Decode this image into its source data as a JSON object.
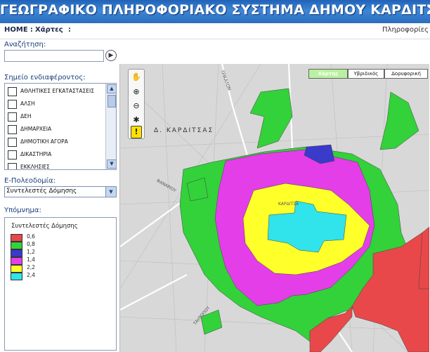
{
  "header": {
    "title": "ΓΕΩΓΡΑΦΙΚΟ ΠΛΗΡΟΦΟΡΙΑΚΟ ΣΥΣΤΗΜΑ ΔΗΜΟΥ ΚΑΡΔΙΤΣΑΣ"
  },
  "nav": {
    "home": "HOME",
    "separator": ":",
    "current": "Χάρτες",
    "trailing": ":",
    "info": "Πληροφορίες"
  },
  "sidebar": {
    "search_label": "Αναζήτηση:",
    "search_value": "",
    "go_icon": "arrow-right-icon",
    "poi_label": "Σημείο ενδιαφέροντος:",
    "poi_items": [
      {
        "label": "ΑΘΛΗΤΙΚΕΣ ΕΓΚΑΤΑΣΤΑΣΕΙΣ",
        "checked": false
      },
      {
        "label": "ΑΛΣΗ",
        "checked": false
      },
      {
        "label": "ΔΕΗ",
        "checked": false
      },
      {
        "label": "ΔΗΜΑΡΧΕΙΑ",
        "checked": false
      },
      {
        "label": "ΔΗΜΟΤΙΚΗ ΑΓΟΡΑ",
        "checked": false
      },
      {
        "label": "ΔΙΚΑΣΤΗΡΙΑ",
        "checked": false
      },
      {
        "label": "ΕΚΚΛΗΣΙΕΣ",
        "checked": false
      }
    ],
    "epoleodomia_label": "Ε-Πολεοδομία:",
    "epoleodomia_selected": "Συντελεστές Δόμησης",
    "legend_label": "Υπόμνημα:",
    "legend": {
      "title": "Συντελεστές Δόμησης",
      "items": [
        {
          "value": "0,6",
          "color": "#e8484a"
        },
        {
          "value": "0,8",
          "color": "#33d13a"
        },
        {
          "value": "1,2",
          "color": "#3a3acb"
        },
        {
          "value": "1,4",
          "color": "#e33ee8"
        },
        {
          "value": "2,2",
          "color": "#ffff2a"
        },
        {
          "value": "2,4",
          "color": "#31e3ea"
        }
      ]
    }
  },
  "map": {
    "type_buttons": [
      {
        "label": "Χάρτης",
        "active": true
      },
      {
        "label": "Υβριδικός",
        "active": false
      },
      {
        "label": "Δορυφορική",
        "active": false
      }
    ],
    "tools": [
      "hand-icon",
      "zoom-in-icon",
      "zoom-out-icon",
      "measure-icon",
      "info-warning-icon"
    ],
    "place_label": "Δ. ΚΑΡΔΙΤΣΑΣ",
    "street_labels": [
      "ΤΡΙΚΑΛΩΝ",
      "ΦΑΝΑΡΙΟΥ",
      "ΤΑΥΡΩΠΟΥ"
    ],
    "center_label": "ΚΑΡΔΙΤΣΑ"
  },
  "colors": {
    "zone_0_6": "#e8484a",
    "zone_0_8": "#33d13a",
    "zone_1_2": "#3a3acb",
    "zone_1_4": "#e33ee8",
    "zone_2_2": "#ffff2a",
    "zone_2_4": "#31e3ea"
  }
}
